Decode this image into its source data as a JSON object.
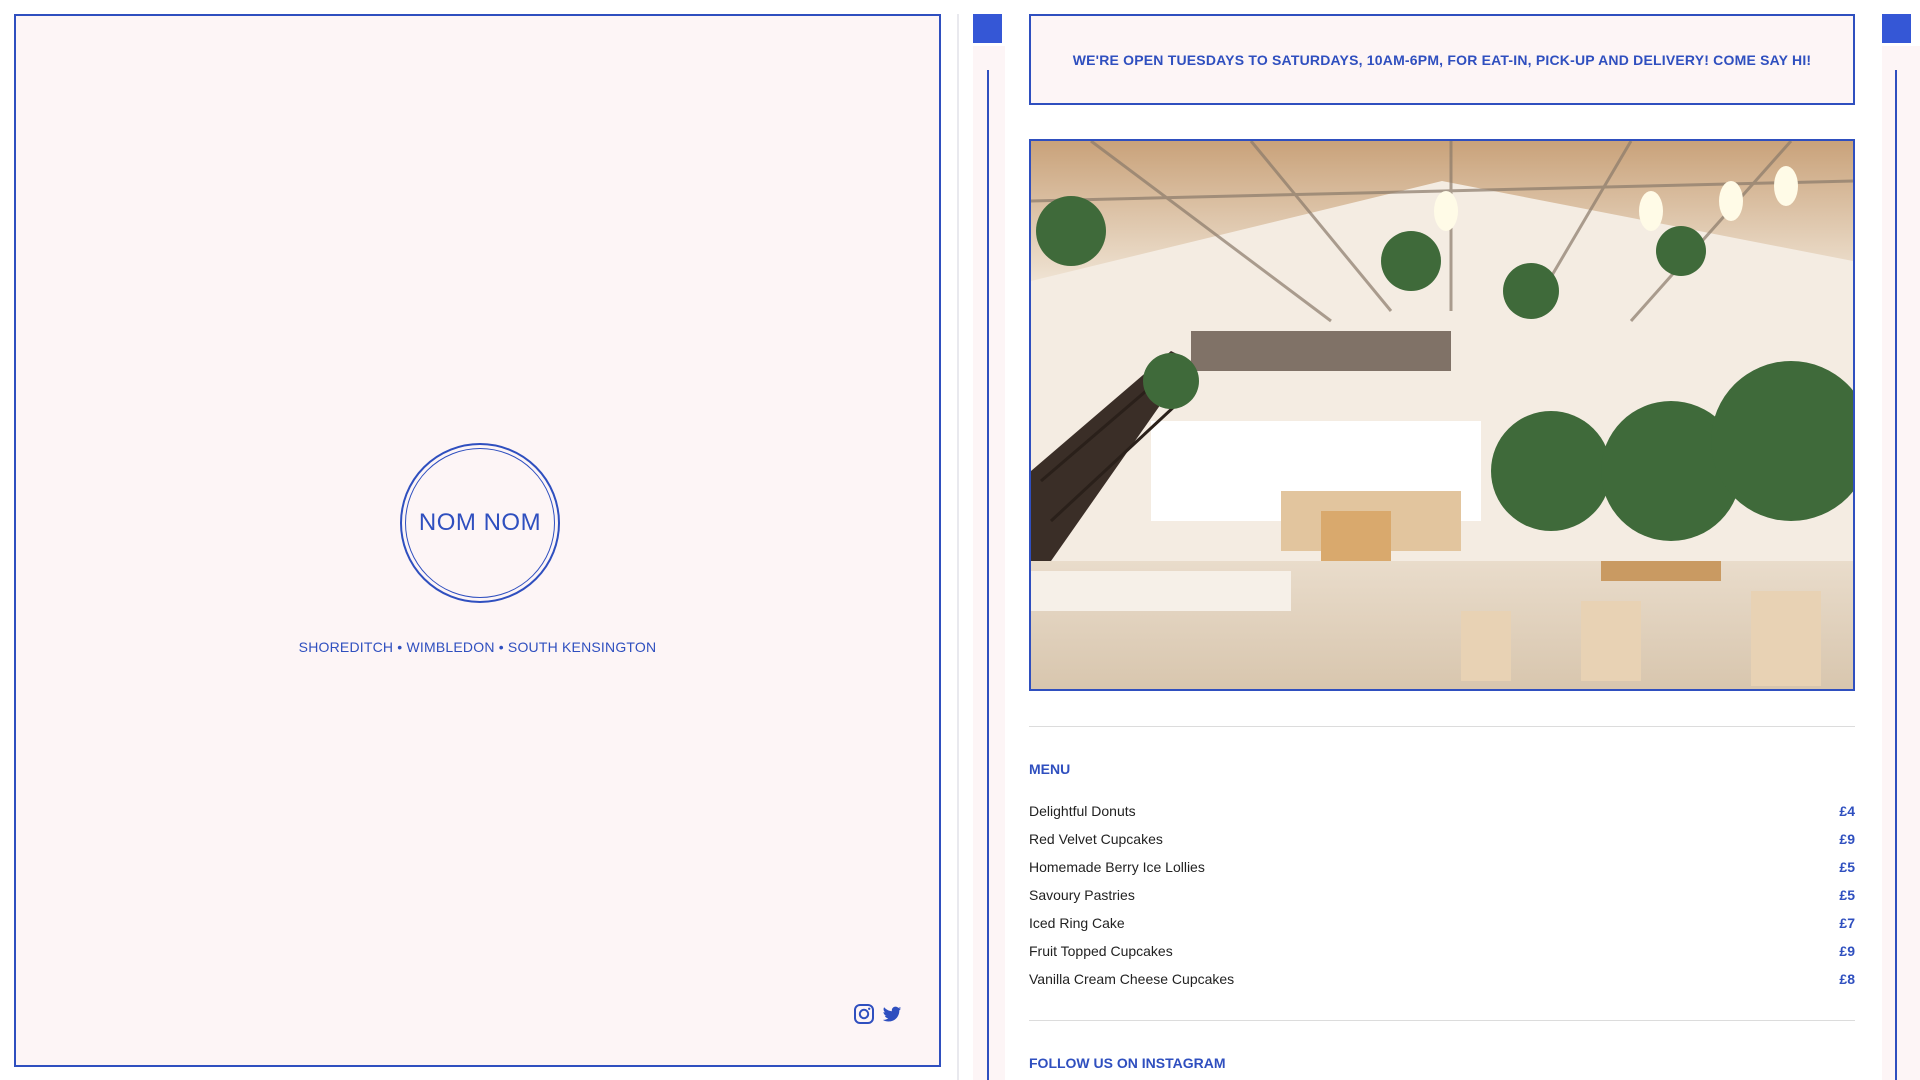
{
  "brand": {
    "logo_text": "NOM NOM",
    "locations": "SHOREDITCH • WIMBLEDON • SOUTH KENSINGTON"
  },
  "social": {
    "icons": [
      "instagram-icon",
      "twitter-icon"
    ]
  },
  "banner": {
    "text": "WE'RE OPEN TUESDAYS TO SATURDAYS, 10AM-6PM, FOR EAT-IN, PICK-UP AND DELIVERY! COME SAY HI!"
  },
  "menu": {
    "heading": "MENU",
    "items": [
      {
        "name": "Delightful Donuts",
        "price": "£4"
      },
      {
        "name": "Red Velvet Cupcakes",
        "price": "£9"
      },
      {
        "name": "Homemade Berry Ice Lollies",
        "price": "£5"
      },
      {
        "name": "Savoury Pastries",
        "price": "£5"
      },
      {
        "name": "Iced Ring Cake",
        "price": "£7"
      },
      {
        "name": "Fruit Topped Cupcakes",
        "price": "£9"
      },
      {
        "name": "Vanilla Cream Cheese Cupcakes",
        "price": "£8"
      }
    ]
  },
  "instagram": {
    "heading": "FOLLOW US ON INSTAGRAM"
  },
  "colors": {
    "accent": "#2f4fbf",
    "accent_square": "#3557d6",
    "panel_bg": "#fdf5f6"
  }
}
